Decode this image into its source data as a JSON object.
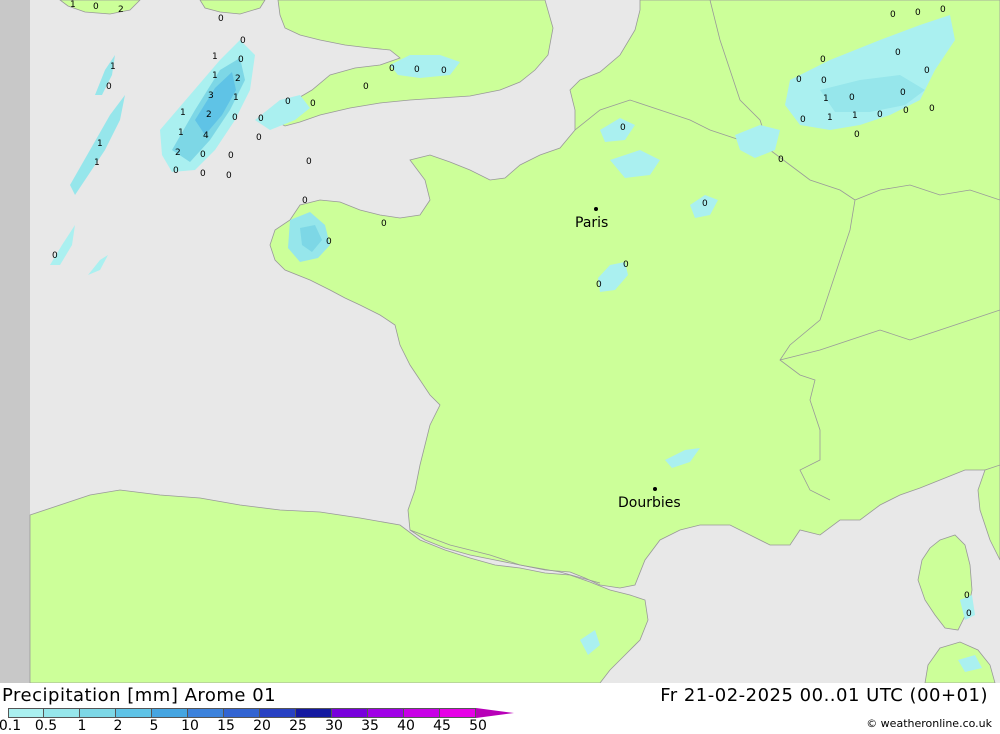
{
  "title": "Precipitation [mm] Arome 01",
  "datetime": "Fr 21-02-2025 00..01 UTC (00+01)",
  "credit": "© weatheronline.co.uk",
  "colors": {
    "sea": "#e8e8e8",
    "land": "#ccff99",
    "border": "#999999",
    "no_data": "#c8c8c8"
  },
  "legend": {
    "labels": [
      "0.1",
      "0.5",
      "1",
      "2",
      "5",
      "10",
      "15",
      "20",
      "25",
      "30",
      "35",
      "40",
      "45",
      "50"
    ],
    "colors": [
      "#aaf0f0",
      "#96e6eb",
      "#7dd7e6",
      "#5fc3e6",
      "#46a5e1",
      "#3c82dc",
      "#3264d2",
      "#2841c3",
      "#1419a0",
      "#7800dc",
      "#a000e6",
      "#c800e6",
      "#e600e6",
      "#b800b8"
    ]
  },
  "cities": [
    {
      "name": "Paris"
    },
    {
      "name": "Dourbies"
    }
  ],
  "values": [
    "1",
    "0",
    "2",
    "0",
    "0",
    "1",
    "0",
    "1",
    "2",
    "3",
    "1",
    "2",
    "0",
    "1",
    "4",
    "0",
    "2",
    "0",
    "0",
    "0",
    "0",
    "0",
    "0",
    "1",
    "0",
    "1",
    "1",
    "1",
    "0",
    "0",
    "0",
    "0",
    "0",
    "0",
    "0",
    "0",
    "0",
    "0",
    "0",
    "0",
    "0",
    "0",
    "0",
    "0",
    "0",
    "0",
    "0",
    "1",
    "1",
    "0",
    "1",
    "0",
    "0",
    "0",
    "0",
    "0",
    "0",
    "0",
    "0",
    "0",
    "0",
    "0",
    "0",
    "0"
  ]
}
